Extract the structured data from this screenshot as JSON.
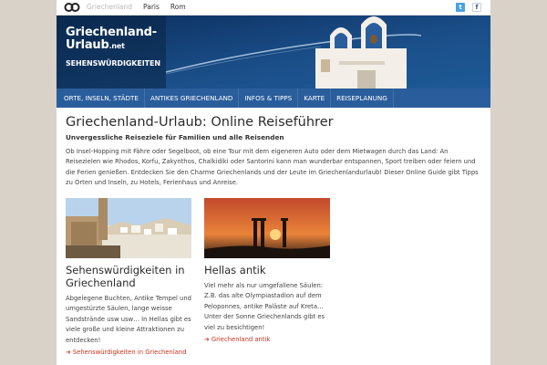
{
  "topbar": {
    "links": [
      {
        "label": "Griechenland",
        "active": true
      },
      {
        "label": "Paris",
        "active": false
      },
      {
        "label": "Rom",
        "active": false
      }
    ],
    "twitter_label": "t",
    "facebook_label": "f"
  },
  "banner": {
    "brand_title_line1": "Griechenland-",
    "brand_title_line2": "Urlaub",
    "brand_suffix": ".net",
    "brand_sub": "SEHENSWÜRDIGKEITEN"
  },
  "nav": {
    "items": [
      "ORTE, INSELN, STÄDTE",
      "ANTIKES GRIECHENLAND",
      "INFOS & TIPPS",
      "KARTE",
      "REISEPLANUNG"
    ]
  },
  "main": {
    "title": "Griechenland-Urlaub: Online Reiseführer",
    "tagline": "Unvergessliche Reiseziele für Familien und alle Reisenden",
    "intro": "Ob Insel-Hopping mit Fähre oder Segelboot, ob eine Tour mit dem eigeneren Auto oder dem Mietwagen durch das Land: An Reisezielen wie Rhodos, Korfu, Zakynthos, Chalkidiki oder Santorini kann man wunderbar entspannen, Sport treiben oder feiern und die Ferien genießen. Entdecken Sie den Charme Griechenlands und der Leute im Griechenlandurlaub! Dieser Online Guide gibt Tipps zu Orten und Inseln, zu Hotels, Ferienhaus und Anreise."
  },
  "cards": [
    {
      "title": "Sehenswürdigkeiten in Griechenland",
      "text": "Abgelegene Buchten, Antike Tempel und umgestürzte Säulen, lange weisse Sandstrände usw usw… In Hellas gibt es viele große und kleine Attraktionen zu entdecken!",
      "link": "Sehenswürdigkeiten in Griechenland"
    },
    {
      "title": "Hellas antik",
      "text": "Viel mehr als nur umgefallene Säulen: Z.B. das alte Olympiastadion auf dem Peloponnes, antike Paläste auf Kreta… Unter der Sonne Griechenlands gibt es viel zu besichtigen!",
      "link": "Griechenland antik"
    }
  ]
}
